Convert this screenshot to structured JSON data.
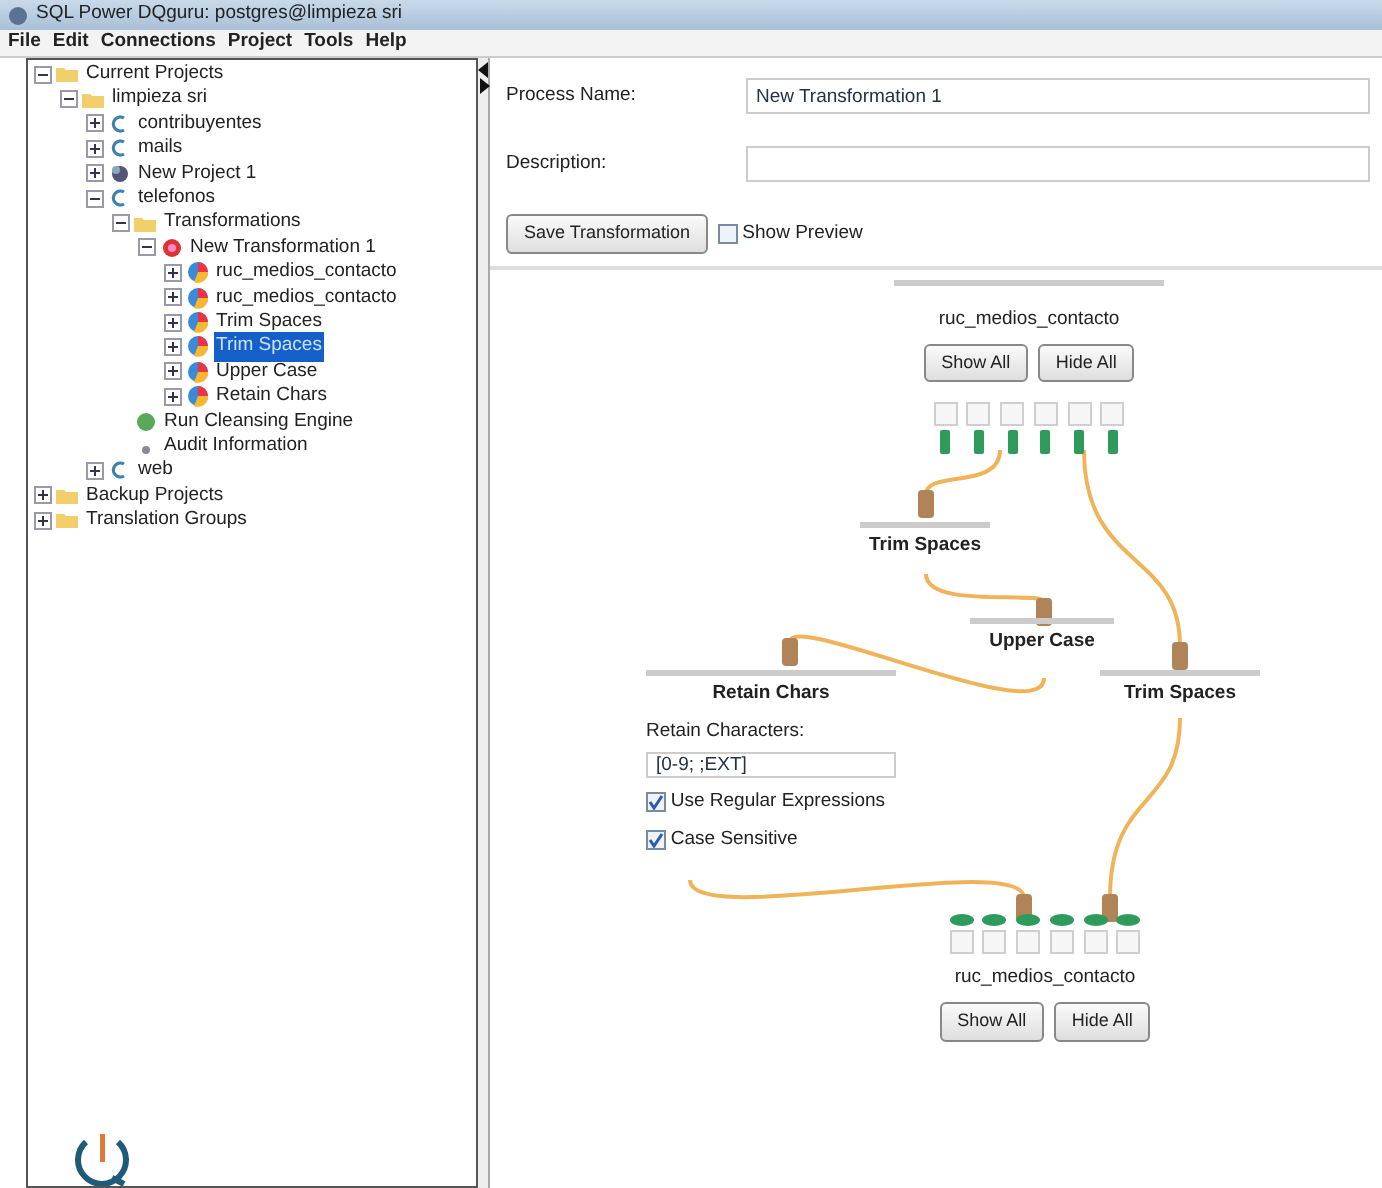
{
  "window": {
    "title": "SQL Power DQguru: postgres@limpieza sri"
  },
  "menu": [
    "File",
    "Edit",
    "Connections",
    "Project",
    "Tools",
    "Help"
  ],
  "tree": [
    {
      "label": "Current Projects",
      "kind": "folder",
      "expanded": true,
      "selected": false,
      "children": [
        {
          "label": "limpieza sri",
          "kind": "folder",
          "expanded": true,
          "selected": false,
          "children": [
            {
              "label": "contribuyentes",
              "kind": "database",
              "expanded": false,
              "selected": false
            },
            {
              "label": "mails",
              "kind": "database",
              "expanded": false,
              "selected": false
            },
            {
              "label": "New Project 1",
              "kind": "project",
              "expanded": false,
              "selected": false
            },
            {
              "label": "telefonos",
              "kind": "database",
              "expanded": true,
              "selected": false,
              "children": [
                {
                  "label": "Transformations",
                  "kind": "folder",
                  "expanded": true,
                  "selected": false,
                  "children": [
                    {
                      "label": "New Transformation 1",
                      "kind": "transformation",
                      "expanded": true,
                      "selected": false,
                      "children": [
                        {
                          "label": "ruc_medios_contacto",
                          "kind": "step",
                          "expanded": false,
                          "selected": false
                        },
                        {
                          "label": "ruc_medios_contacto",
                          "kind": "step",
                          "expanded": false,
                          "selected": false
                        },
                        {
                          "label": "Trim Spaces",
                          "kind": "step",
                          "expanded": false,
                          "selected": false
                        },
                        {
                          "label": "Trim Spaces",
                          "kind": "step",
                          "expanded": false,
                          "selected": true
                        },
                        {
                          "label": "Upper Case",
                          "kind": "step",
                          "expanded": false,
                          "selected": false
                        },
                        {
                          "label": "Retain Chars",
                          "kind": "step",
                          "expanded": false,
                          "selected": false
                        }
                      ]
                    }
                  ]
                },
                {
                  "label": "Run Cleansing Engine",
                  "kind": "engine",
                  "selected": false
                },
                {
                  "label": "Audit Information",
                  "kind": "audit",
                  "selected": false
                }
              ]
            },
            {
              "label": "web",
              "kind": "database",
              "expanded": false,
              "selected": false
            }
          ]
        }
      ]
    },
    {
      "label": "Backup Projects",
      "kind": "folder",
      "expanded": false,
      "selected": false
    },
    {
      "label": "Translation Groups",
      "kind": "folder",
      "expanded": false,
      "selected": false
    }
  ],
  "form": {
    "process_name_label": "Process Name:",
    "process_name": "New Transformation 1",
    "description_label": "Description:",
    "save_button": "Save Transformation",
    "show_preview": {
      "label": "Show Preview",
      "checked": false
    }
  },
  "canvas": {
    "nodes": [
      {
        "kind": "source",
        "name": "ruc_medios_contacto",
        "buttons": [
          "Show All",
          "Hide All"
        ]
      },
      {
        "kind": "step",
        "name": "Trim Spaces"
      },
      {
        "kind": "step",
        "name": "Upper Case"
      },
      {
        "kind": "step",
        "name": "Retain Chars",
        "field_label": "Retain Characters:",
        "value": "[0-9; ;EXT]",
        "options": [
          {
            "label": "Use Regular Expressions",
            "checked": true
          },
          {
            "label": "Case Sensitive",
            "checked": true
          }
        ]
      },
      {
        "kind": "step",
        "name": "Trim Spaces"
      },
      {
        "kind": "target",
        "name": "ruc_medios_contacto",
        "buttons": [
          "Show All",
          "Hide All"
        ]
      }
    ]
  }
}
